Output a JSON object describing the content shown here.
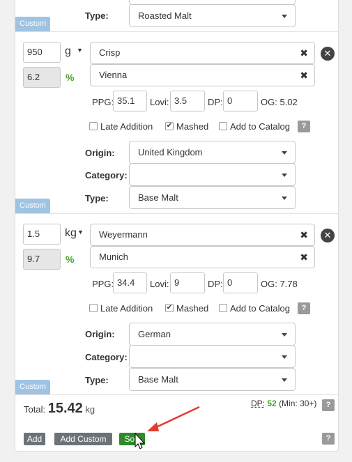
{
  "blocks": [
    {
      "custom_label": "Custom",
      "origin_label": "Origin:",
      "category_label": "Category:",
      "type_label": "Type:",
      "type_value": "Roasted Malt"
    },
    {
      "amount": "950",
      "unit": "g",
      "percent": "6.2",
      "percent_sign": "%",
      "name1": "Crisp",
      "name2": "Vienna",
      "ppg_label": "PPG:",
      "ppg": "35.1",
      "lovi_label": "Lovi:",
      "lovi": "3.5",
      "dp_label": "DP:",
      "dp": "0",
      "og": "OG: 5.02",
      "late_addition": "Late Addition",
      "mashed": "Mashed",
      "add_to_catalog": "Add to Catalog",
      "help": "?",
      "origin_label": "Origin:",
      "origin": "United Kingdom",
      "category_label": "Category:",
      "category": "",
      "type_label": "Type:",
      "type_value": "Base Malt",
      "custom_label": "Custom"
    },
    {
      "amount": "1.5",
      "unit": "kg",
      "percent": "9.7",
      "percent_sign": "%",
      "name1": "Weyermann",
      "name2": "Munich",
      "ppg_label": "PPG:",
      "ppg": "34.4",
      "lovi_label": "Lovi:",
      "lovi": "9",
      "dp_label": "DP:",
      "dp": "0",
      "og": "OG: 7.78",
      "late_addition": "Late Addition",
      "mashed": "Mashed",
      "add_to_catalog": "Add to Catalog",
      "help": "?",
      "origin_label": "Origin:",
      "origin": "German",
      "category_label": "Category:",
      "category": "",
      "type_label": "Type:",
      "type_value": "Base Malt",
      "custom_label": "Custom"
    }
  ],
  "footer": {
    "total_label": "Total:",
    "total_value": "15.42",
    "total_unit": "kg",
    "dp_label": "DP:",
    "dp_value": "52",
    "dp_min": "(Min: 30+)",
    "help": "?",
    "add": "Add",
    "add_custom": "Add Custom",
    "sort": "Sort"
  },
  "colors": {
    "accent_green": "#49a32c",
    "custom_tag": "#9fc3e2",
    "sort_button": "#2e8a2a",
    "arrow": "#e53b2c"
  }
}
